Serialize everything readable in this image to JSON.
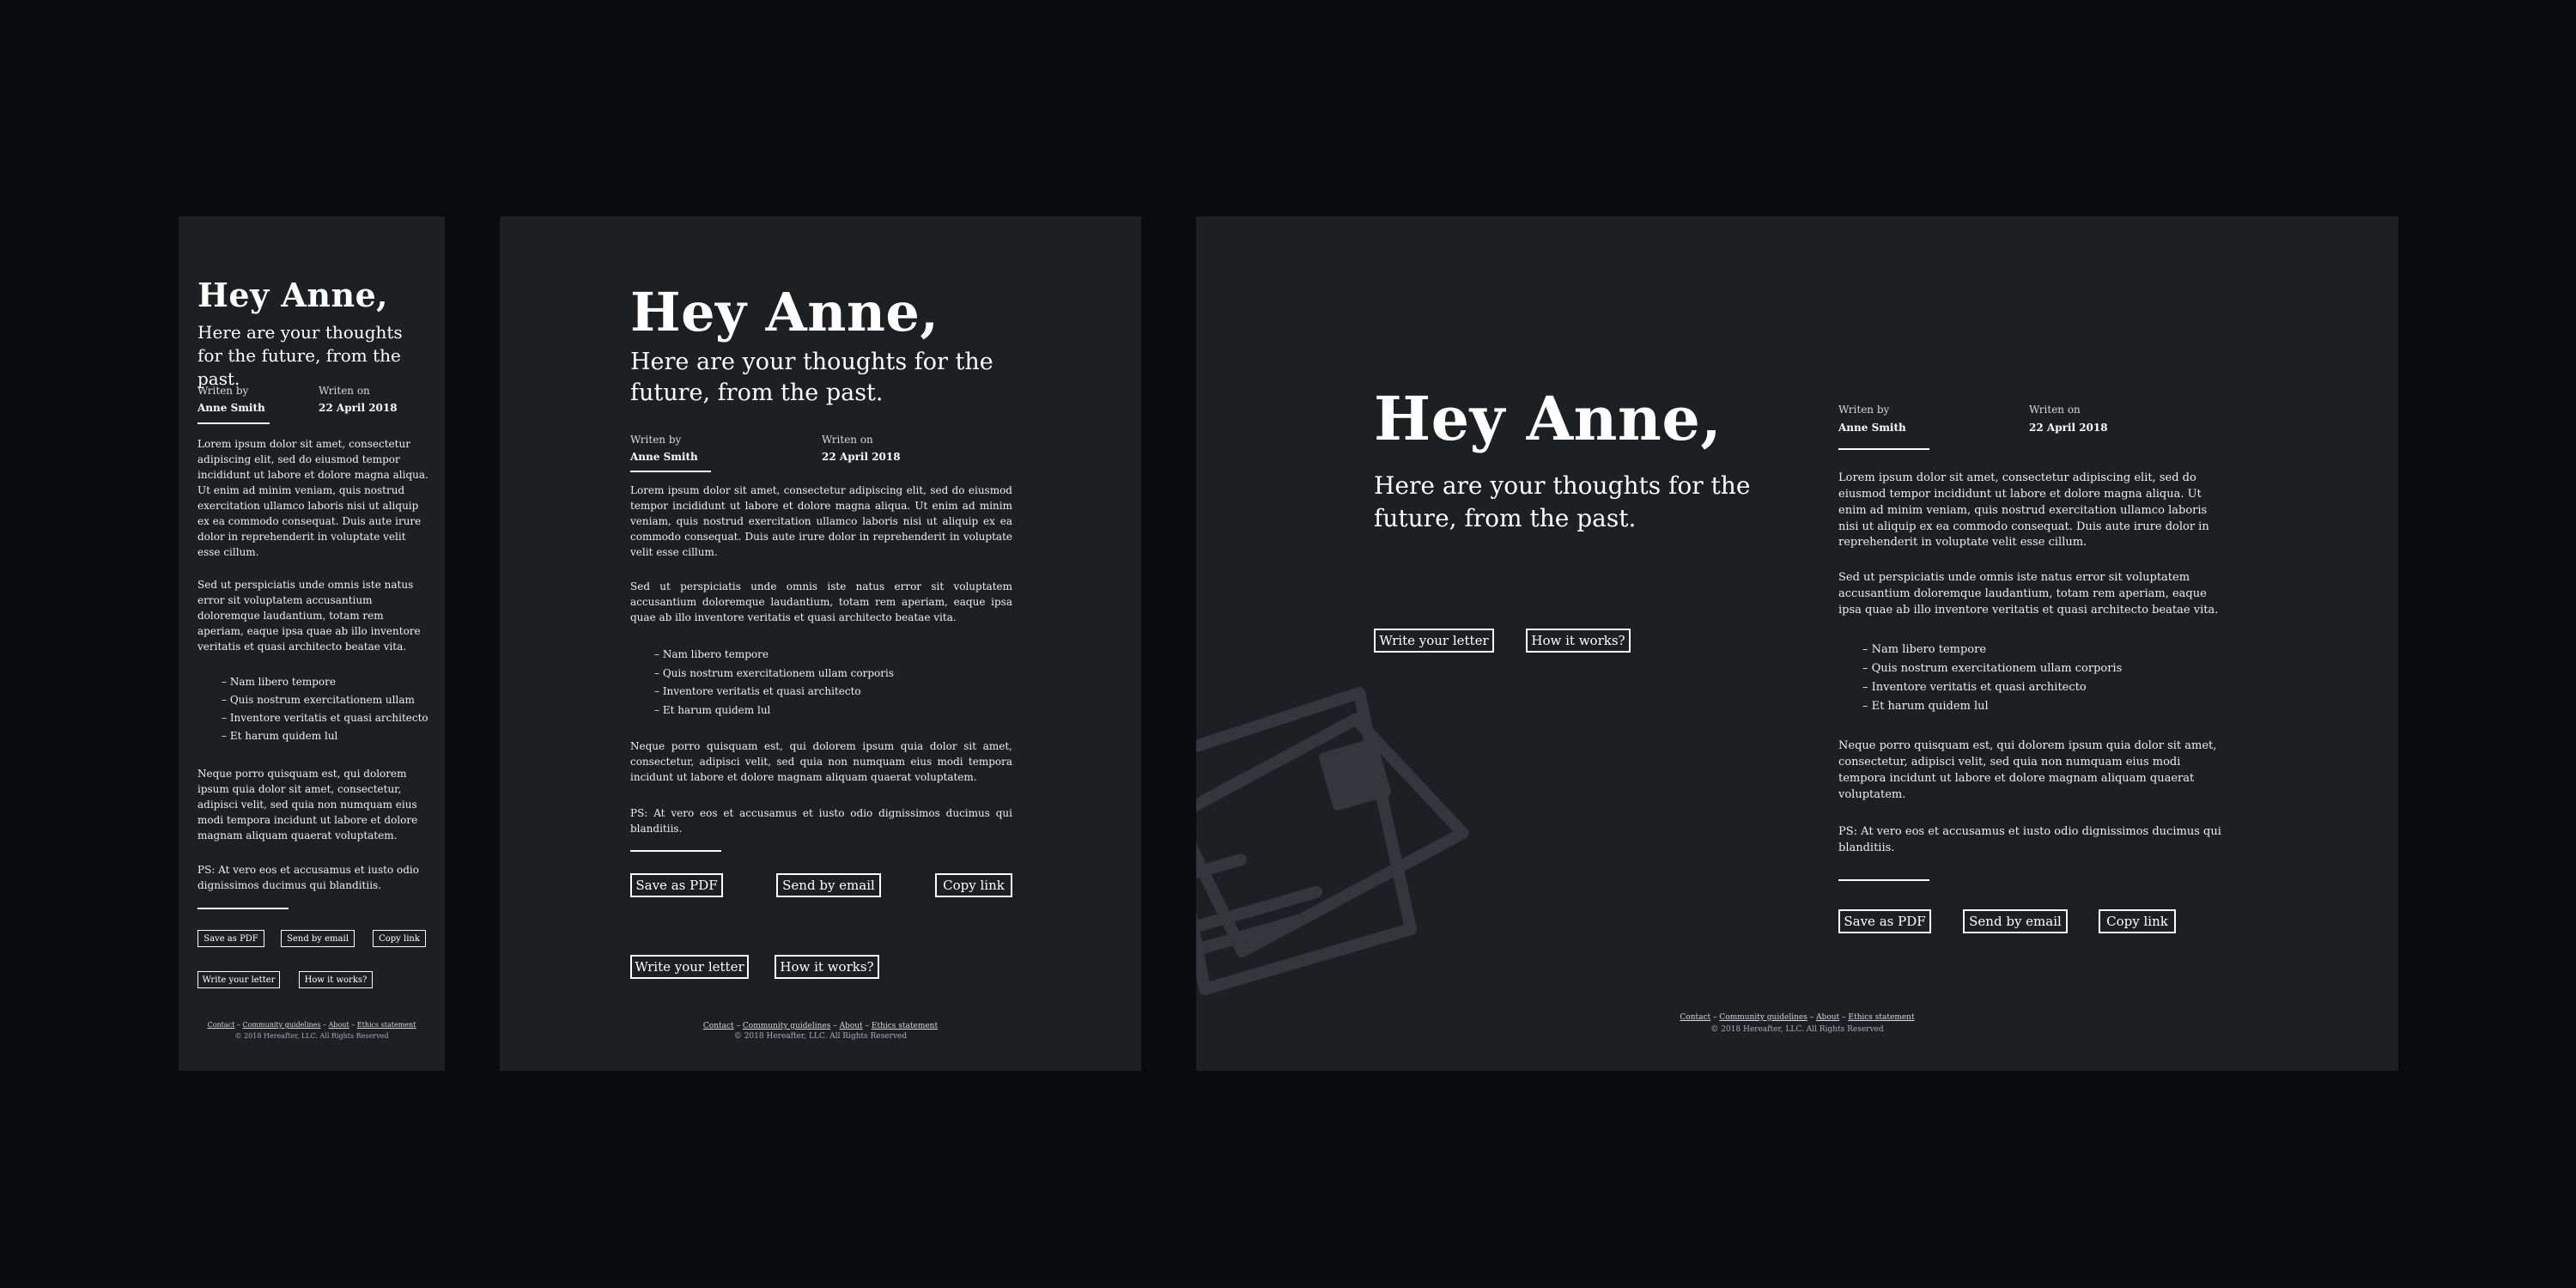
{
  "letter": {
    "greeting": "Hey Anne,",
    "subtitle": "Here are your thoughts for the future, from the past.",
    "written_by_label": "Writen by",
    "author": "Anne Smith",
    "written_on_label": "Writen on",
    "date": "22 April 2018",
    "para1": "Lorem ipsum dolor sit amet, consectetur adipiscing elit, sed do eiusmod tempor incididunt ut labore et dolore magna aliqua. Ut enim ad minim veniam, quis nostrud exercitation ullamco laboris nisi ut aliquip ex ea commodo consequat. Duis aute irure dolor in reprehenderit in voluptate velit esse cillum.",
    "para2": "Sed ut perspiciatis unde omnis iste natus error sit voluptatem accusantium doloremque laudantium, totam rem aperiam, eaque ipsa quae ab illo inventore veritatis et quasi architecto beatae vita.",
    "bullets": [
      "– Nam libero tempore",
      "– Quis nostrum exercitationem ullam corporis",
      "– Inventore veritatis et quasi architecto",
      "– Et harum quidem lul"
    ],
    "bullets_compact": [
      "– Nam libero tempore",
      "– Quis nostrum exercitationem ullam",
      "– Inventore veritatis et quasi architecto",
      "– Et harum quidem lul"
    ],
    "para3": "Neque porro quisquam est, qui dolorem ipsum quia dolor sit amet, consectetur, adipisci velit, sed quia non numquam eius modi tempora incidunt ut labore et dolore magnam aliquam quaerat voluptatem.",
    "ps": "PS: At vero eos et accusamus et iusto odio dignissimos ducimus qui blanditiis."
  },
  "actions": {
    "save_pdf": "Save as PDF",
    "send_email": "Send by email",
    "copy_link": "Copy link",
    "write_letter": "Write your letter",
    "how_it_works": "How it works?"
  },
  "footer": {
    "links": [
      "Contact",
      "Community guidelines",
      "About",
      "Ethics statement"
    ],
    "separator": " – ",
    "copyright": "© 2018 Hereafter, LLC. All Rights Reserved"
  },
  "illustration": {
    "icon": "envelope-icon"
  },
  "colors": {
    "page_background": "#0a0b0c",
    "panel_background": "#1d1f23",
    "text": "#ffffff",
    "illustration": "#33363b"
  }
}
